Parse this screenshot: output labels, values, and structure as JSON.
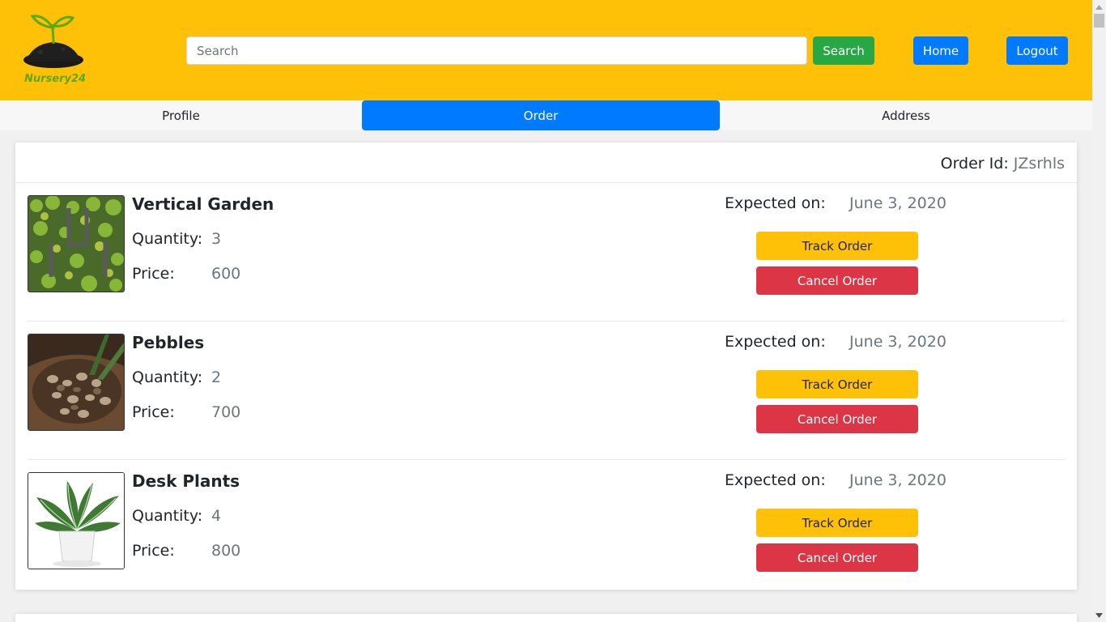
{
  "header": {
    "brand": "Nursery24",
    "search": {
      "placeholder": "Search",
      "value": ""
    },
    "search_button": "Search",
    "home_button": "Home",
    "logout_button": "Logout",
    "background_color": "#ffc107"
  },
  "tabs": [
    {
      "label": "Profile",
      "active": false
    },
    {
      "label": "Order",
      "active": true
    },
    {
      "label": "Address",
      "active": false
    }
  ],
  "order": {
    "id_label": "Order Id:",
    "id_value": "JZsrhls",
    "items": [
      {
        "name": "Vertical Garden",
        "quantity_label": "Quantity:",
        "quantity": "3",
        "price_label": "Price:",
        "price": "600",
        "expected_label": "Expected on:",
        "expected_date": "June 3, 2020",
        "track_label": "Track Order",
        "cancel_label": "Cancel Order",
        "image_icon": "vertical-garden-image"
      },
      {
        "name": "Pebbles",
        "quantity_label": "Quantity:",
        "quantity": "2",
        "price_label": "Price:",
        "price": "700",
        "expected_label": "Expected on:",
        "expected_date": "June 3, 2020",
        "track_label": "Track Order",
        "cancel_label": "Cancel Order",
        "image_icon": "pebbles-image"
      },
      {
        "name": "Desk Plants",
        "quantity_label": "Quantity:",
        "quantity": "4",
        "price_label": "Price:",
        "price": "800",
        "expected_label": "Expected on:",
        "expected_date": "June 3, 2020",
        "track_label": "Track Order",
        "cancel_label": "Cancel Order",
        "image_icon": "desk-plant-image"
      }
    ]
  },
  "colors": {
    "primary": "#007bff",
    "success": "#28a745",
    "warning": "#ffc107",
    "danger": "#dc3545",
    "muted": "#6c757d"
  }
}
